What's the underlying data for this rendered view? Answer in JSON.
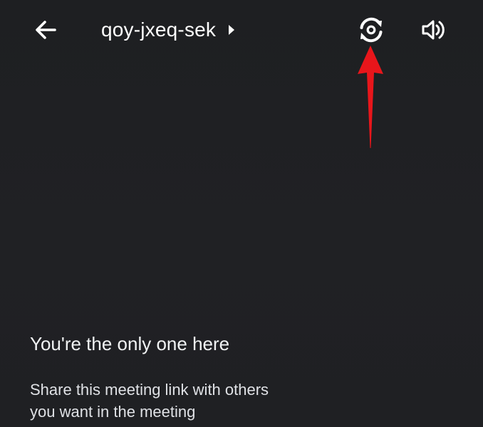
{
  "header": {
    "meeting_code": "qoy-jxeq-sek",
    "back_icon": "arrow-left-icon",
    "details_icon": "caret-right-icon",
    "switch_camera_icon": "switch-camera-icon",
    "audio_icon": "speaker-volume-icon"
  },
  "empty_state": {
    "title": "You're the only one here",
    "description_line1": "Share this meeting link with others",
    "description_line2": "you want in the meeting"
  },
  "annotation": {
    "color": "#e8161b",
    "target": "switch-camera-button"
  },
  "colors": {
    "background": "#202124",
    "foreground": "#ffffff"
  }
}
